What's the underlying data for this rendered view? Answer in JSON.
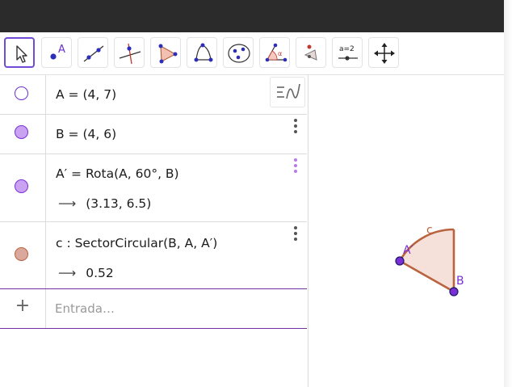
{
  "toolbar": {
    "tools": [
      {
        "name": "move-tool-icon"
      },
      {
        "name": "point-tool-icon",
        "label": "A"
      },
      {
        "name": "line-tool-icon"
      },
      {
        "name": "perpendicular-line-tool-icon"
      },
      {
        "name": "polygon-tool-icon"
      },
      {
        "name": "circle-tool-icon"
      },
      {
        "name": "conic-tool-icon"
      },
      {
        "name": "angle-tool-icon",
        "label": "α"
      },
      {
        "name": "reflect-tool-icon"
      },
      {
        "name": "slider-tool-icon",
        "label": "a=2"
      },
      {
        "name": "move-graphics-tool-icon"
      }
    ]
  },
  "algebra": {
    "rows": [
      {
        "definition": "A = (4, 7)",
        "marble": "empty"
      },
      {
        "definition": "B = (4, 6)",
        "marble": "filled"
      },
      {
        "definition": "A′ = Rota(A, 60°, B)",
        "output": "(3.13, 6.5)",
        "marble": "filled"
      },
      {
        "definition": "c : SectorCircular(B, A, A′)",
        "output": "0.52",
        "marble": "filled-sector"
      }
    ],
    "input": {
      "placeholder": "Entrada…"
    }
  },
  "graphics": {
    "labels": {
      "point_a_prime": "A′",
      "point_b": "B",
      "sector": "c"
    }
  },
  "colors": {
    "accent": "#6f4bd8",
    "point": "#7a2fd6",
    "point_marble": "#c9a3f2",
    "sector_stroke": "#b9633f",
    "sector_fill": "#f6e1da",
    "sector_marble": "#dba89c"
  }
}
